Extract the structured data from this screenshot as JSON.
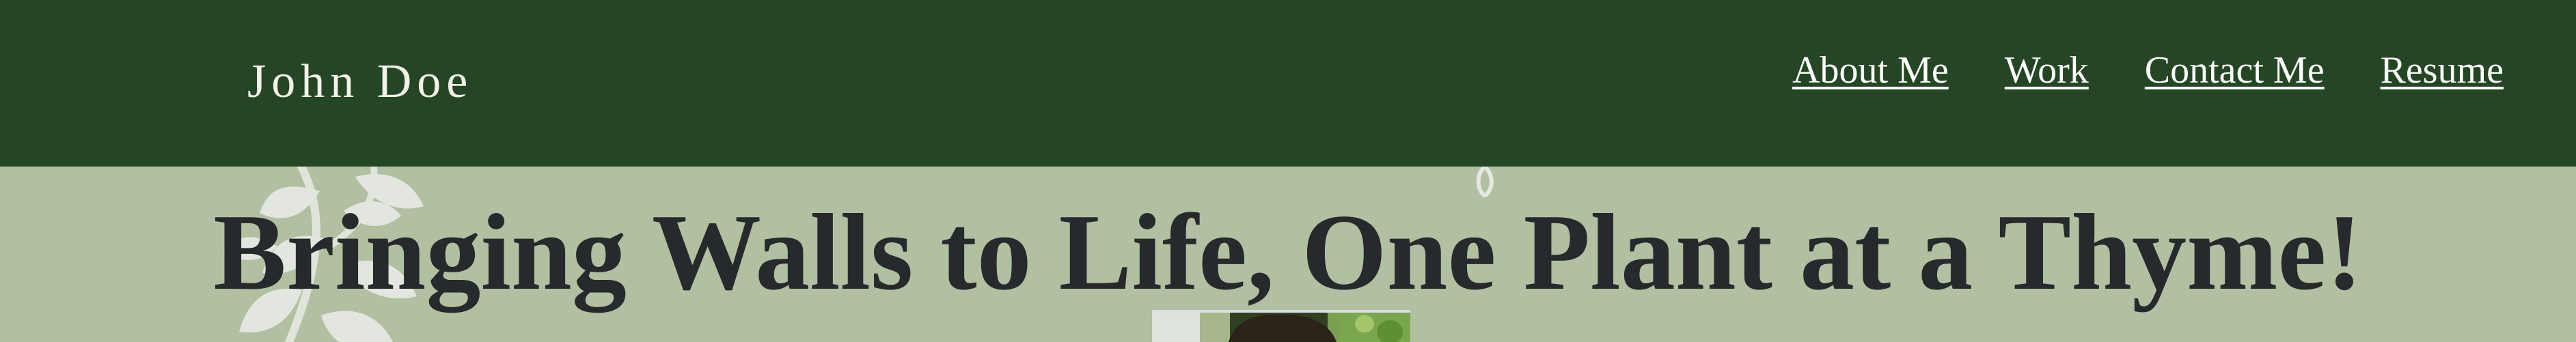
{
  "site": {
    "name": "John Doe"
  },
  "nav": {
    "items": [
      {
        "label": "About Me"
      },
      {
        "label": "Work"
      },
      {
        "label": "Contact Me"
      },
      {
        "label": "Resume"
      }
    ]
  },
  "hero": {
    "title": "Bringing Walls to Life, One Plant at a Thyme!"
  },
  "icons": {
    "decor_left": "leaf-branch-icon",
    "decor_top": "small-leaf-icon"
  },
  "colors": {
    "header": "#244624",
    "hero_background": "#b0c0a0",
    "title_text": "#262a2d",
    "nav_text": "#ffffff"
  }
}
